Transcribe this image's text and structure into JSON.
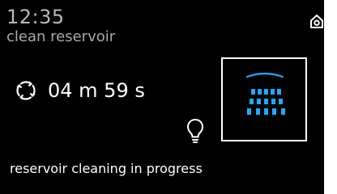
{
  "header": {
    "time": "12:35",
    "program": "clean reservoir"
  },
  "icons": {
    "home": "home-icon",
    "cycle": "cycle-icon",
    "bulb": "bulb-icon",
    "spray": "spray-icon"
  },
  "timer": {
    "remaining": "04 m 59 s"
  },
  "status": {
    "message": "reservoir cleaning in progress"
  },
  "colors": {
    "background": "#000000",
    "text": "#ffffff",
    "muted_text": "#b9b9b9",
    "accent": "#1fa8ff",
    "frame": "#ffffff"
  }
}
